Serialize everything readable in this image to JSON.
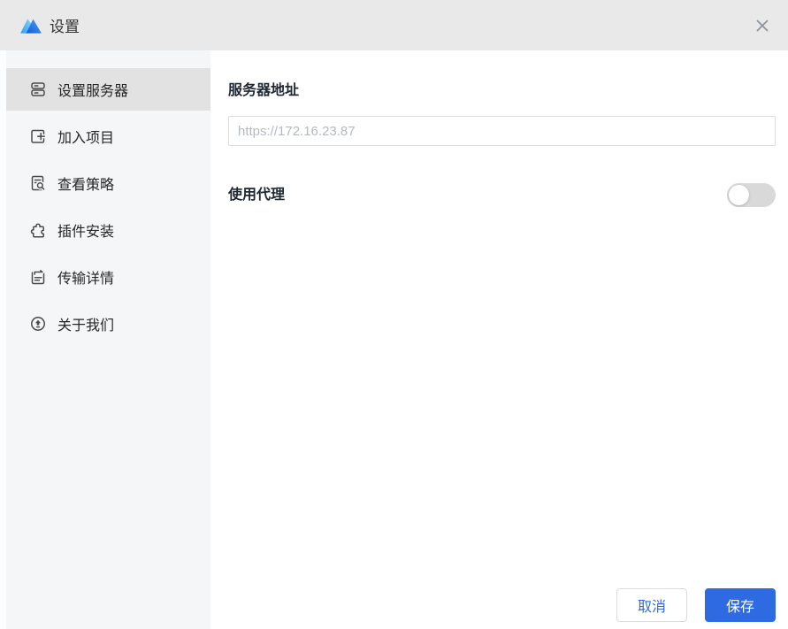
{
  "window": {
    "title": "设置"
  },
  "sidebar": {
    "items": [
      {
        "label": "设置服务器",
        "icon": "server-icon",
        "selected": true
      },
      {
        "label": "加入项目",
        "icon": "add-project-icon",
        "selected": false
      },
      {
        "label": "查看策略",
        "icon": "view-policy-icon",
        "selected": false
      },
      {
        "label": "插件安装",
        "icon": "plugin-icon",
        "selected": false
      },
      {
        "label": "传输详情",
        "icon": "transfer-details-icon",
        "selected": false
      },
      {
        "label": "关于我们",
        "icon": "about-us-icon",
        "selected": false
      }
    ]
  },
  "main": {
    "server_address": {
      "label": "服务器地址",
      "value": "",
      "placeholder": "https://172.16.23.87"
    },
    "proxy": {
      "label": "使用代理",
      "enabled": false
    },
    "footer": {
      "cancel_label": "取消",
      "save_label": "保存"
    }
  },
  "colors": {
    "accent_blue": "#2e6be2",
    "titlebar_bg": "#e9e9e9",
    "sidebar_bg": "#f5f6f7",
    "selected_item_bg": "#e2e2e2",
    "toggle_off_track": "#d9d9d9"
  }
}
